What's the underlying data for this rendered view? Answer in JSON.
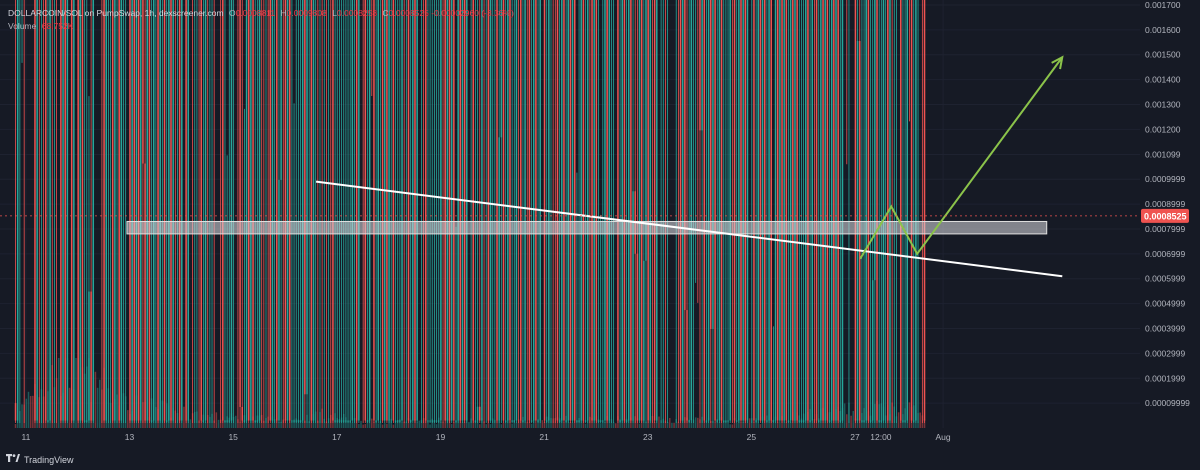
{
  "header": {
    "symbol": "DOLLARCOIN/SOL on PumpSwap, 1h, dexscreener.com",
    "open_label": "O",
    "open": "0.0008811",
    "high_label": "H",
    "high": "0.0009808",
    "low_label": "L",
    "low": "0.0008258",
    "close_label": "C",
    "close": "0.0008525",
    "change": "-0.00002960 (-3.36%)",
    "volume_label": "Volume",
    "volume": "68.752K"
  },
  "footer": {
    "logo_icon": "tradingview-logo-icon",
    "brand": "TradingView"
  },
  "colors": {
    "up": "#26a69a",
    "down": "#ef5350",
    "bg": "#161a25",
    "arrow": "#8bc34a",
    "trendline": "#ffffff"
  },
  "chart_data": {
    "type": "candlestick",
    "y_axis": {
      "scale": "linear",
      "ticks": [
        "0.00009999",
        "0.0001999",
        "0.0002999",
        "0.0003999",
        "0.0004999",
        "0.0005999",
        "0.0006999",
        "0.0007999",
        "0.0008999",
        "0.0009999",
        "0.001099",
        "0.001200",
        "0.001300",
        "0.001400",
        "0.001500",
        "0.001600",
        "0.001700"
      ],
      "range": [
        0.0,
        0.00172
      ]
    },
    "x_axis": {
      "ticks": [
        "11",
        "13",
        "15",
        "17",
        "19",
        "21",
        "23",
        "25",
        "27",
        "12:00",
        "Aug"
      ],
      "range_days": [
        10.5,
        32.5
      ]
    },
    "current_price_label": "0.0008525",
    "resistance_zone": {
      "from": 0.00078,
      "to": 0.00083
    },
    "trendline": {
      "start": {
        "day": 16.6,
        "price": 0.00099
      },
      "end": {
        "day": 31.0,
        "price": 0.00061
      }
    },
    "projection_path": [
      {
        "day": 27.1,
        "price": 0.00068
      },
      {
        "day": 27.7,
        "price": 0.00089
      },
      {
        "day": 28.2,
        "price": 0.0007
      },
      {
        "day": 31.0,
        "price": 0.00149
      }
    ],
    "price_path": [
      {
        "day": 10.8,
        "price": 0.0001
      },
      {
        "day": 11.0,
        "price": 0.00045
      },
      {
        "day": 11.2,
        "price": 0.00085
      },
      {
        "day": 11.4,
        "price": 0.0013
      },
      {
        "day": 11.6,
        "price": 0.0016
      },
      {
        "day": 11.75,
        "price": 0.0011
      },
      {
        "day": 11.9,
        "price": 0.0015
      },
      {
        "day": 12.1,
        "price": 0.0017
      },
      {
        "day": 12.2,
        "price": 0.0006
      },
      {
        "day": 12.4,
        "price": 0.00085
      },
      {
        "day": 12.6,
        "price": 0.0012
      },
      {
        "day": 12.8,
        "price": 0.00095
      },
      {
        "day": 13.0,
        "price": 0.0008
      },
      {
        "day": 13.3,
        "price": 0.0007
      },
      {
        "day": 13.7,
        "price": 0.00065
      },
      {
        "day": 14.0,
        "price": 0.00057
      },
      {
        "day": 14.3,
        "price": 0.00045
      },
      {
        "day": 14.7,
        "price": 0.00035
      },
      {
        "day": 15.2,
        "price": 0.0003
      },
      {
        "day": 15.7,
        "price": 0.00026
      },
      {
        "day": 16.2,
        "price": 0.00035
      },
      {
        "day": 16.5,
        "price": 0.0005
      },
      {
        "day": 16.6,
        "price": 0.0009
      },
      {
        "day": 16.8,
        "price": 0.00075
      },
      {
        "day": 17.2,
        "price": 0.00055
      },
      {
        "day": 17.7,
        "price": 0.00044
      },
      {
        "day": 18.2,
        "price": 0.00036
      },
      {
        "day": 18.6,
        "price": 0.00032
      },
      {
        "day": 19.0,
        "price": 0.0004
      },
      {
        "day": 19.4,
        "price": 0.00035
      },
      {
        "day": 19.7,
        "price": 0.00046
      },
      {
        "day": 20.0,
        "price": 0.00062
      },
      {
        "day": 20.4,
        "price": 0.00055
      },
      {
        "day": 20.8,
        "price": 0.00047
      },
      {
        "day": 21.2,
        "price": 0.00044
      },
      {
        "day": 21.7,
        "price": 0.00055
      },
      {
        "day": 22.2,
        "price": 0.0005
      },
      {
        "day": 22.6,
        "price": 0.00065
      },
      {
        "day": 22.8,
        "price": 0.0008
      },
      {
        "day": 23.0,
        "price": 0.00065
      },
      {
        "day": 23.4,
        "price": 0.00052
      },
      {
        "day": 23.8,
        "price": 0.00065
      },
      {
        "day": 24.2,
        "price": 0.00058
      },
      {
        "day": 24.6,
        "price": 0.00052
      },
      {
        "day": 25.0,
        "price": 0.0005
      },
      {
        "day": 25.5,
        "price": 0.00047
      },
      {
        "day": 26.0,
        "price": 0.00048
      },
      {
        "day": 26.5,
        "price": 0.00044
      },
      {
        "day": 26.9,
        "price": 0.00068
      },
      {
        "day": 27.2,
        "price": 0.00055
      },
      {
        "day": 27.5,
        "price": 0.00052
      },
      {
        "day": 27.8,
        "price": 0.00075
      },
      {
        "day": 28.0,
        "price": 0.00088
      },
      {
        "day": 28.2,
        "price": 0.00098
      },
      {
        "day": 28.35,
        "price": 0.000853
      }
    ],
    "volume_path": [
      {
        "day": 10.8,
        "volume": 0.1
      },
      {
        "day": 11.1,
        "volume": 0.7
      },
      {
        "day": 11.6,
        "volume": 1.0
      },
      {
        "day": 12.2,
        "volume": 0.9
      },
      {
        "day": 12.8,
        "volume": 0.55
      },
      {
        "day": 13.5,
        "volume": 0.35
      },
      {
        "day": 14.5,
        "volume": 0.2
      },
      {
        "day": 16.0,
        "volume": 0.14
      },
      {
        "day": 16.6,
        "volume": 0.25
      },
      {
        "day": 17.5,
        "volume": 0.12
      },
      {
        "day": 20.0,
        "volume": 0.13
      },
      {
        "day": 22.8,
        "volume": 0.16
      },
      {
        "day": 25.0,
        "volume": 0.12
      },
      {
        "day": 26.8,
        "volume": 0.3
      },
      {
        "day": 28.0,
        "volume": 0.35
      },
      {
        "day": 28.35,
        "volume": 0.2
      }
    ]
  }
}
